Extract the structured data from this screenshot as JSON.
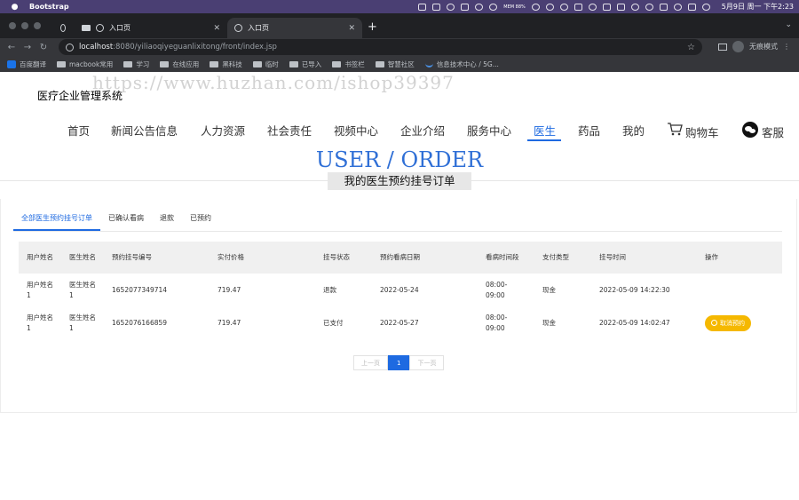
{
  "os": {
    "app_name": "Bootstrap",
    "clock": "5月9日 周一 下午2:23",
    "battery": "MEM 88%"
  },
  "browser": {
    "tabs": [
      {
        "label": ""
      },
      {
        "label": "入口页"
      },
      {
        "label": "入口页"
      }
    ],
    "url_host": "localhost",
    "url_path": ":8080/yiliaoqiyeguanlixitong/front/index.jsp",
    "incognito_label": "无痕模式",
    "bookmarks": [
      {
        "label": "百度翻译"
      },
      {
        "label": "macbook常用"
      },
      {
        "label": "学习"
      },
      {
        "label": "在线应用"
      },
      {
        "label": "黑科技"
      },
      {
        "label": "临时"
      },
      {
        "label": "已导入"
      },
      {
        "label": "书签栏"
      },
      {
        "label": "智慧社区"
      },
      {
        "label": "信息技术中心 / 5G..."
      }
    ]
  },
  "watermark": "https://www.huzhan.com/ishop39397",
  "site": {
    "name": "医疗企业管理系统",
    "nav": [
      {
        "label": "首页"
      },
      {
        "label": "新闻公告信息"
      },
      {
        "label": "人力资源"
      },
      {
        "label": "社会责任"
      },
      {
        "label": "视频中心"
      },
      {
        "label": "企业介绍"
      },
      {
        "label": "服务中心"
      },
      {
        "label": "医生"
      },
      {
        "label": "药品"
      },
      {
        "label": "我的"
      },
      {
        "label": "购物车"
      },
      {
        "label": "客服"
      }
    ],
    "active_nav": "医生",
    "accent_color": "#1e6ae1"
  },
  "hero": {
    "title": "USER / ORDER",
    "subtitle": "我的医生预约挂号订单"
  },
  "order_tabs": [
    {
      "label": "全部医生预约挂号订单"
    },
    {
      "label": "已确认看病"
    },
    {
      "label": "退款"
    },
    {
      "label": "已预约"
    }
  ],
  "table": {
    "headers": [
      "用户姓名",
      "医生姓名",
      "预约挂号编号",
      "实付价格",
      "挂号状态",
      "预约看病日期",
      "看病时间段",
      "支付类型",
      "挂号时间",
      "操作"
    ],
    "rows": [
      {
        "user": "用户姓名1",
        "doctor": "医生姓名1",
        "number": "1652077349714",
        "price": "719.47",
        "status": "退款",
        "date": "2022-05-24",
        "slot": "08:00-09:00",
        "pay": "现金",
        "time": "2022-05-09 14:22:30",
        "action": ""
      },
      {
        "user": "用户姓名1",
        "doctor": "医生姓名1",
        "number": "1652076166859",
        "price": "719.47",
        "status": "已支付",
        "date": "2022-05-27",
        "slot": "08:00-09:00",
        "pay": "现金",
        "time": "2022-05-09 14:02:47",
        "action": "取消预约"
      }
    ]
  },
  "pager": {
    "prev": "上一页",
    "current": "1",
    "next": "下一页"
  }
}
